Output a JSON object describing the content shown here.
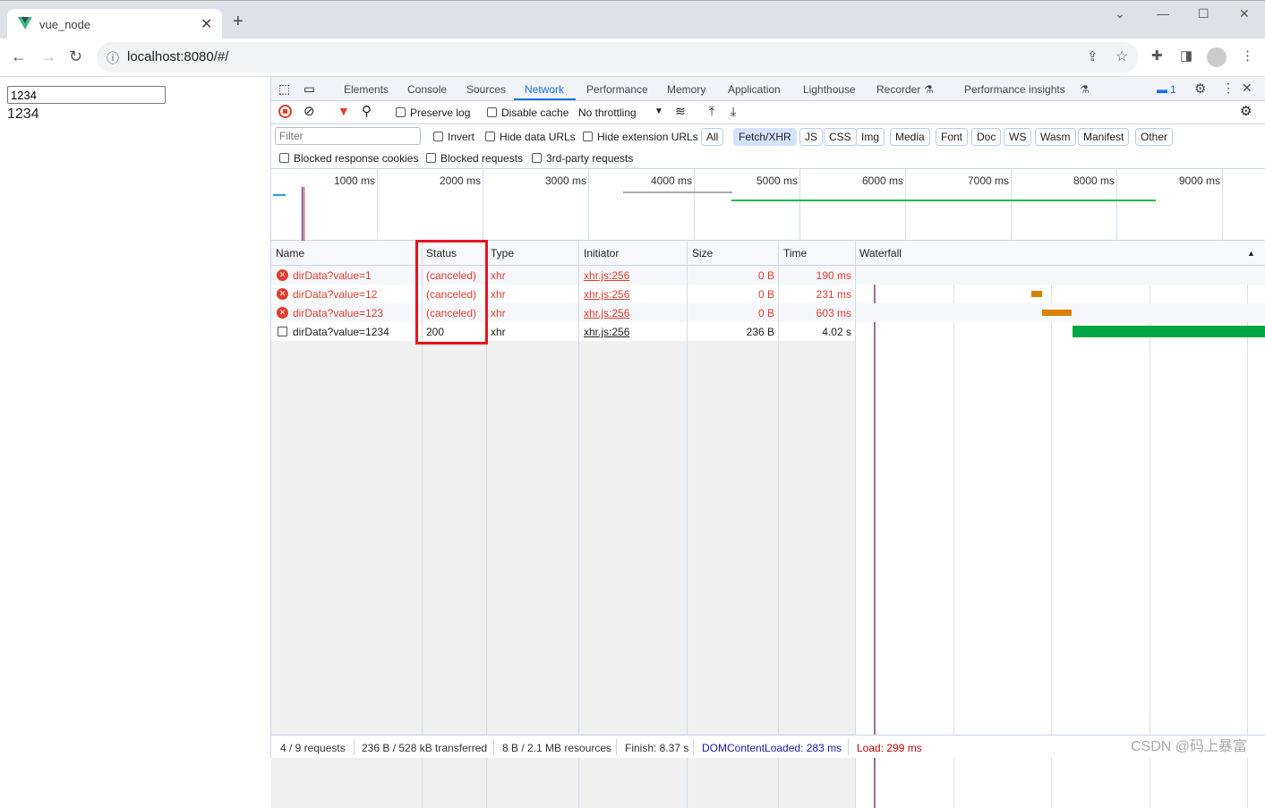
{
  "browser": {
    "tab_title": "vue_node",
    "url": "localhost:8080/#/"
  },
  "page": {
    "input_value": "1234",
    "text": "1234"
  },
  "devtools": {
    "tabs": [
      "Elements",
      "Console",
      "Sources",
      "Network",
      "Performance",
      "Memory",
      "Application",
      "Lighthouse",
      "Recorder",
      "Performance insights"
    ],
    "active_tab": "Network",
    "issues_count": "1",
    "toolbar": {
      "preserve_log": "Preserve log",
      "disable_cache": "Disable cache",
      "throttling": "No throttling"
    },
    "filter": {
      "placeholder": "Filter",
      "invert": "Invert",
      "hide_data": "Hide data URLs",
      "hide_ext": "Hide extension URLs",
      "types": [
        "All",
        "Fetch/XHR",
        "JS",
        "CSS",
        "Img",
        "Media",
        "Font",
        "Doc",
        "WS",
        "Wasm",
        "Manifest",
        "Other"
      ],
      "selected_type": "Fetch/XHR",
      "blocked_cookies": "Blocked response cookies",
      "blocked_requests": "Blocked requests",
      "third_party": "3rd-party requests"
    },
    "overview_ticks": [
      "1000 ms",
      "2000 ms",
      "3000 ms",
      "4000 ms",
      "5000 ms",
      "6000 ms",
      "7000 ms",
      "8000 ms",
      "9000 ms"
    ],
    "columns": [
      "Name",
      "Status",
      "Type",
      "Initiator",
      "Size",
      "Time",
      "Waterfall"
    ],
    "requests": [
      {
        "name": "dirData?value=1",
        "status": "(canceled)",
        "type": "xhr",
        "initiator": "xhr.js:256",
        "size": "0 B",
        "time": "190 ms",
        "error": true
      },
      {
        "name": "dirData?value=12",
        "status": "(canceled)",
        "type": "xhr",
        "initiator": "xhr.js:256",
        "size": "0 B",
        "time": "231 ms",
        "error": true
      },
      {
        "name": "dirData?value=123",
        "status": "(canceled)",
        "type": "xhr",
        "initiator": "xhr.js:256",
        "size": "0 B",
        "time": "603 ms",
        "error": true
      },
      {
        "name": "dirData?value=1234",
        "status": "200",
        "type": "xhr",
        "initiator": "xhr.js:256",
        "size": "236 B",
        "time": "4.02 s",
        "error": false
      }
    ],
    "statusbar": {
      "requests": "4 / 9 requests",
      "transferred": "236 B / 528 kB transferred",
      "resources": "8 B / 2.1 MB resources",
      "finish": "Finish: 8.37 s",
      "dcl": "DOMContentLoaded: 283 ms",
      "load": "Load: 299 ms"
    }
  },
  "watermark": "CSDN @码上暴富",
  "colors": {
    "accent": "#1a73e8",
    "error": "#e23c2c",
    "highlight_box": "#e8121f",
    "waterfall_pending": "#d98100",
    "waterfall_success": "#00a645"
  }
}
